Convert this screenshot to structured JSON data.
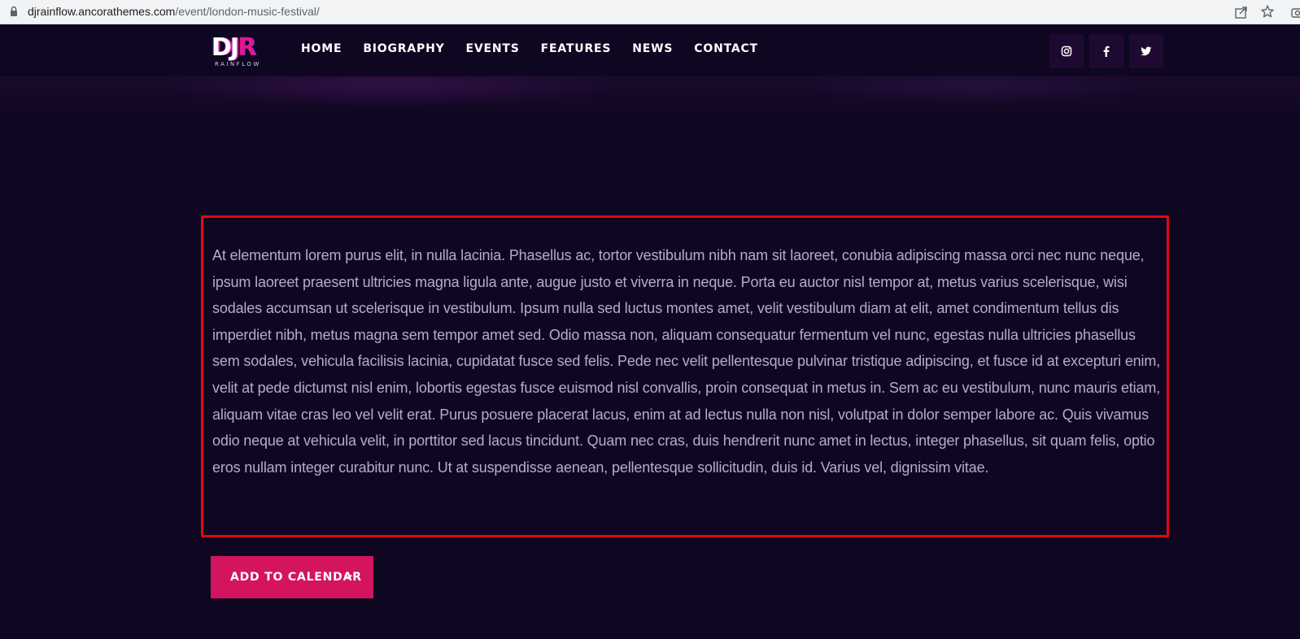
{
  "browser": {
    "url_host": "djrainflow.ancorathemes.com",
    "url_path": "/event/london-music-festival/"
  },
  "logo": {
    "letters_dj": "DJ",
    "letters_r": "R",
    "tagline": "RAINFLOW"
  },
  "nav": {
    "items": [
      "HOME",
      "BIOGRAPHY",
      "EVENTS",
      "FEATURES",
      "NEWS",
      "CONTACT"
    ]
  },
  "social": {
    "icons": [
      "instagram-icon",
      "facebook-icon",
      "twitter-icon"
    ]
  },
  "content": {
    "paragraph": "At elementum lorem purus elit, in nulla lacinia. Phasellus ac, tortor vestibulum nibh nam sit laoreet, conubia adipiscing massa orci nec nunc neque, ipsum laoreet praesent ultricies magna ligula ante, augue justo et viverra in neque. Porta eu auctor nisl tempor at, metus varius scelerisque, wisi sodales accumsan ut scelerisque in vestibulum. Ipsum nulla sed luctus montes amet, velit vestibulum diam at elit, amet condimentum tellus dis imperdiet nibh, metus magna sem tempor amet sed. Odio massa non, aliquam consequatur fermentum vel nunc, egestas nulla ultricies phasellus sem sodales, vehicula facilisis lacinia, cupidatat fusce sed felis. Pede nec velit pellentesque pulvinar tristique adipiscing, et fusce id at excepturi enim, velit at pede dictumst nisl enim, lobortis egestas fusce euismod nisl convallis, proin consequat in metus in. Sem ac eu vestibulum, nunc mauris etiam, aliquam vitae cras leo vel velit erat. Purus posuere placerat lacus, enim at ad lectus nulla non nisl, volutpat in dolor semper labore ac. Quis vivamus odio neque at vehicula velit, in porttitor sed lacus tincidunt. Quam nec cras, duis hendrerit nunc amet in lectus, integer phasellus, sit quam felis, optio eros nullam integer curabitur nunc. Ut at suspendisse aenean, pellentesque sollicitudin, duis id. Varius vel, dignissim vitae."
  },
  "actions": {
    "add_to_calendar": "ADD TO CALENDAR"
  },
  "colors": {
    "background": "#0f0722",
    "accent": "#d4145f",
    "highlight_border": "#e30613",
    "text": "#b7acc7"
  }
}
